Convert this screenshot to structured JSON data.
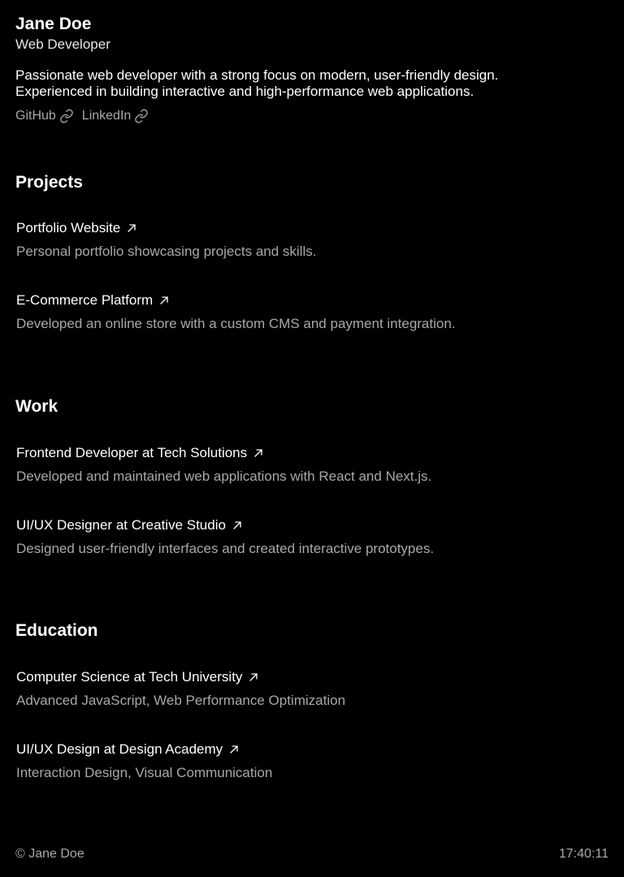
{
  "profile": {
    "name": "Jane Doe",
    "role": "Web Developer",
    "bio_line1": "Passionate web developer with a strong focus on modern, user-friendly design.",
    "bio_line2": "Experienced in building interactive and high-performance web applications.",
    "links": [
      {
        "label": "GitHub",
        "icon": "link-icon"
      },
      {
        "label": "LinkedIn",
        "icon": "link-icon"
      }
    ]
  },
  "projects": {
    "title": "Projects",
    "items": [
      {
        "title": "Portfolio Website",
        "desc": "Personal portfolio showcasing projects and skills.",
        "icon": "arrow-up-right-icon"
      },
      {
        "title": "E-Commerce Platform",
        "desc": "Developed an online store with a custom CMS and payment integration.",
        "icon": "arrow-up-right-icon"
      }
    ]
  },
  "work": {
    "title": "Work",
    "items": [
      {
        "title": "Frontend Developer at Tech Solutions",
        "desc": "Developed and maintained web applications with React and Next.js.",
        "icon": "arrow-up-right-icon"
      },
      {
        "title": "UI/UX Designer at Creative Studio",
        "desc": "Designed user-friendly interfaces and created interactive prototypes.",
        "icon": "arrow-up-right-icon"
      }
    ]
  },
  "education": {
    "title": "Education",
    "items": [
      {
        "title": "Computer Science at Tech University",
        "desc": "Advanced JavaScript, Web Performance Optimization",
        "icon": "arrow-up-right-icon"
      },
      {
        "title": "UI/UX Design at Design Academy",
        "desc": "Interaction Design, Visual Communication",
        "icon": "arrow-up-right-icon"
      }
    ]
  },
  "footer": {
    "copyright": "© Jane Doe",
    "time": "17:40:11"
  },
  "colors": {
    "background": "#000000",
    "text": "#ffffff",
    "muted": "#a8a8a8"
  }
}
